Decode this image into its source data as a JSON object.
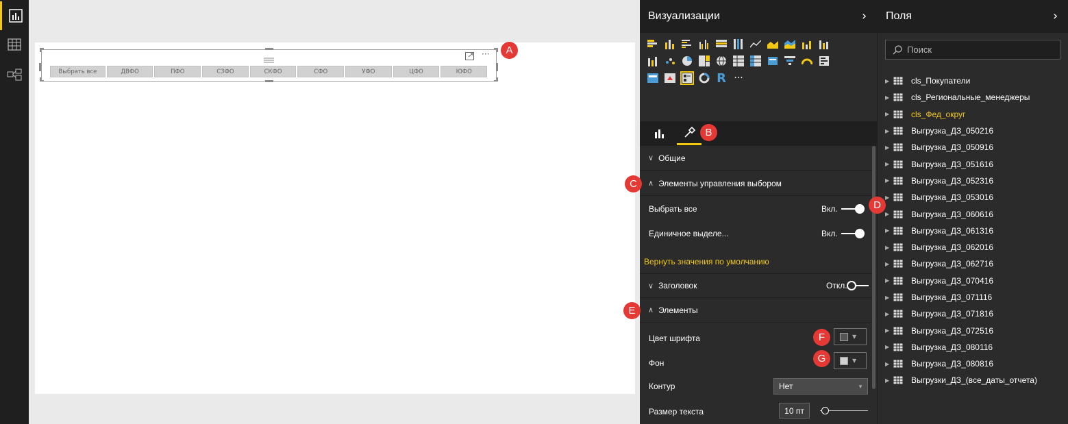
{
  "badges": [
    "A",
    "B",
    "C",
    "D",
    "E",
    "F",
    "G"
  ],
  "slicer": {
    "items": [
      "Выбрать все",
      "ДВФО",
      "ПФО",
      "СЗФО",
      "СКФО",
      "СФО",
      "УФО",
      "ЦФО",
      "ЮФО"
    ],
    "more_label": "···"
  },
  "viz_pane": {
    "title": "Визуализации",
    "more_label": "···",
    "r_label": "R",
    "sections": {
      "general": "Общие",
      "selection_controls": "Элементы управления выбором",
      "header": "Заголовок",
      "items": "Элементы"
    },
    "props": {
      "select_all": {
        "label": "Выбрать все",
        "state": "Вкл."
      },
      "single_select": {
        "label": "Единичное выделе...",
        "state": "Вкл."
      },
      "reset": "Вернуть значения по умолчанию",
      "header_state": "Откл.",
      "font_color": "Цвет шрифта",
      "background": "Фон",
      "outline": "Контур",
      "outline_value": "Нет",
      "text_size": "Размер текста",
      "text_size_value": "10 пт"
    }
  },
  "fields_pane": {
    "title": "Поля",
    "search_placeholder": "Поиск",
    "items": [
      "cls_Покупатели",
      "cls_Региональные_менеджеры",
      "cls_Фед_округ",
      "Выгрузка_ДЗ_050216",
      "Выгрузка_ДЗ_050916",
      "Выгрузка_ДЗ_051616",
      "Выгрузка_ДЗ_052316",
      "Выгрузка_ДЗ_053016",
      "Выгрузка_ДЗ_060616",
      "Выгрузка_ДЗ_061316",
      "Выгрузка_ДЗ_062016",
      "Выгрузка_ДЗ_062716",
      "Выгрузка_ДЗ_070416",
      "Выгрузка_ДЗ_071116",
      "Выгрузка_ДЗ_071816",
      "Выгрузка_ДЗ_072516",
      "Выгрузка_ДЗ_080116",
      "Выгрузка_ДЗ_080816",
      "Выгрузки_ДЗ_(все_даты_отчета)"
    ],
    "selected_index": 2
  },
  "colors": {
    "accent": "#f2c811",
    "badge": "#e53935",
    "pane_dark": "#2b2b2b",
    "header_dark": "#1f1f1f"
  }
}
